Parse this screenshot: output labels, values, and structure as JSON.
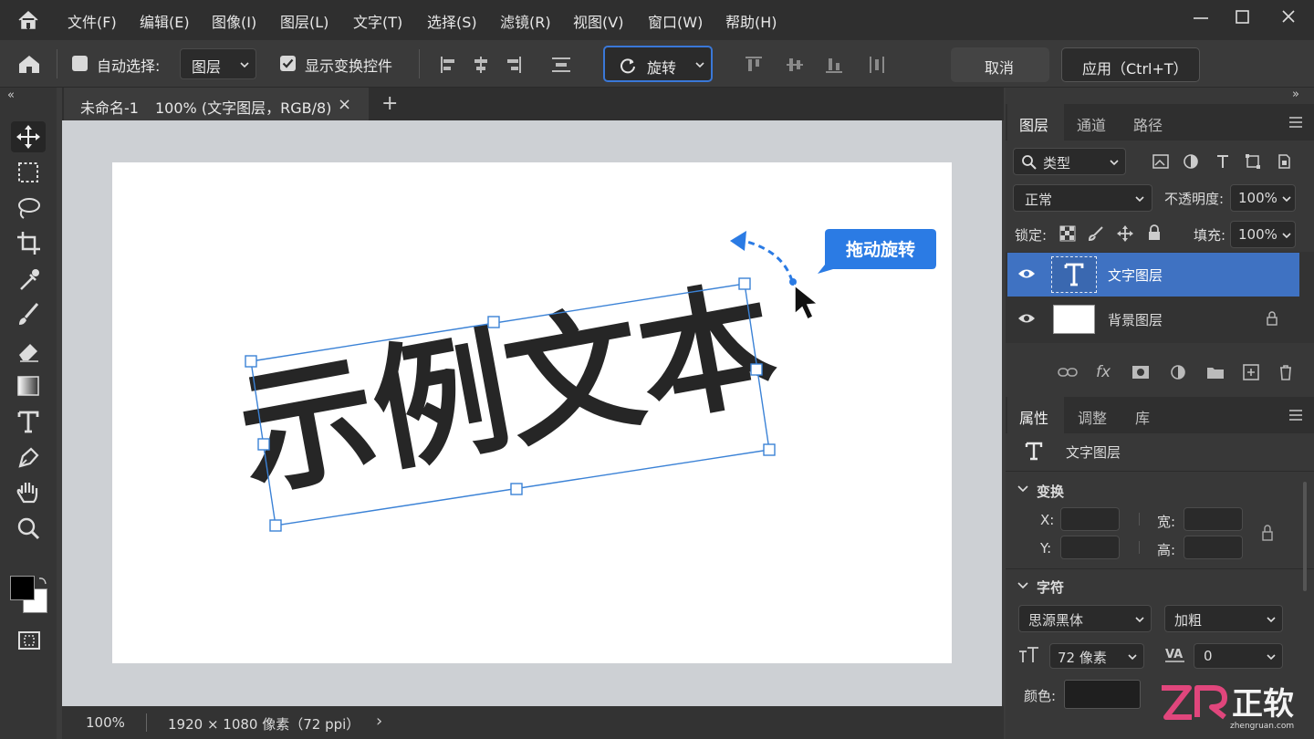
{
  "menu": {
    "items": [
      "文件(F)",
      "编辑(E)",
      "图像(I)",
      "图层(L)",
      "文字(T)",
      "选择(S)",
      "滤镜(R)",
      "视图(V)",
      "窗口(W)",
      "帮助(H)"
    ]
  },
  "options": {
    "auto_select_label": "自动选择:",
    "auto_select_value": "图层",
    "show_transform_label": "显示变换控件",
    "rotate_label": "旋转",
    "cancel_label": "取消",
    "apply_label": "应用（Ctrl+T）"
  },
  "document": {
    "tab_title": "未命名-1",
    "tab_info": "100% (文字图层，RGB/8)",
    "tab_close": "×",
    "new_tab": "+",
    "collapse_left": "«",
    "collapse_right": "»"
  },
  "canvas": {
    "sample_text": "示例文本",
    "callout": "拖动旋转"
  },
  "status": {
    "zoom": "100%",
    "size": "1920 × 1080 像素（72 ppi）",
    "arrow": "›"
  },
  "layers_panel": {
    "tabs": [
      "图层",
      "通道",
      "路径"
    ],
    "filter_label": "类型",
    "blend_mode": "正常",
    "opacity_label": "不透明度:",
    "opacity_value": "100%",
    "lock_label": "锁定:",
    "fill_label": "填充:",
    "fill_value": "100%",
    "layers": [
      {
        "name": "文字图层",
        "selected": true
      },
      {
        "name": "背景图层",
        "selected": false
      }
    ]
  },
  "properties_panel": {
    "tabs": [
      "属性",
      "调整",
      "库"
    ],
    "layer_type": "文字图层",
    "transform_section": "变换",
    "x_label": "X:",
    "y_label": "Y:",
    "w_label": "宽:",
    "h_label": "高:",
    "character_section": "字符",
    "font_family": "思源黑体",
    "font_style": "加粗",
    "font_size": "72 像素",
    "tracking": "0",
    "color_label": "颜色:"
  },
  "watermark": {
    "logo_text": "正软",
    "logo_sub": "zhengruan.com"
  },
  "colors": {
    "accent": "#3a78d8",
    "selected_layer": "#3f72c2",
    "callout_bg": "#2b7be4",
    "canvas_bg": "#cdd0d4"
  }
}
